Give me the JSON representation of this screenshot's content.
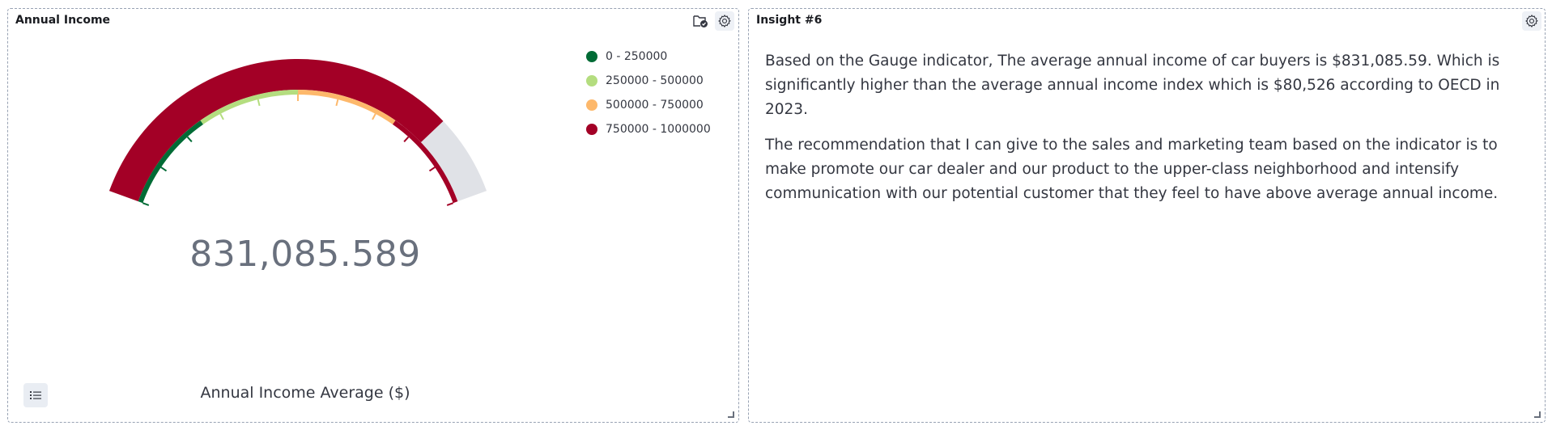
{
  "left_panel": {
    "title": "Annual Income",
    "gauge": {
      "value_text": "831,085.589",
      "value": 831085.589,
      "min": 0,
      "max": 1000000,
      "label": "Annual Income Average ($)",
      "colors": {
        "fill": "#a30026",
        "remaining": "#e0e2e7",
        "ticks": "#69707d"
      }
    },
    "legend": [
      {
        "label": "0 - 250000",
        "color": "#006b35"
      },
      {
        "label": "250000 - 500000",
        "color": "#b4dd7f"
      },
      {
        "label": "500000 - 750000",
        "color": "#fdb86b"
      },
      {
        "label": "750000 - 1000000",
        "color": "#a30026"
      }
    ],
    "icons": [
      "folder-check-icon",
      "gear-icon",
      "list-icon"
    ]
  },
  "right_panel": {
    "title": "Insight #6",
    "paragraphs": [
      "Based on the Gauge indicator, The average annual income of car buyers is $831,085.59. Which is significantly higher than the average annual income index which is $80,526 according to OECD in 2023.",
      "The recommendation that I can give to the sales and marketing team based on the indicator is to make promote our car dealer and our product to the upper-class neighborhood and intensify communication with our potential customer that they feel to have above average annual income."
    ],
    "icons": [
      "gear-icon"
    ]
  }
}
